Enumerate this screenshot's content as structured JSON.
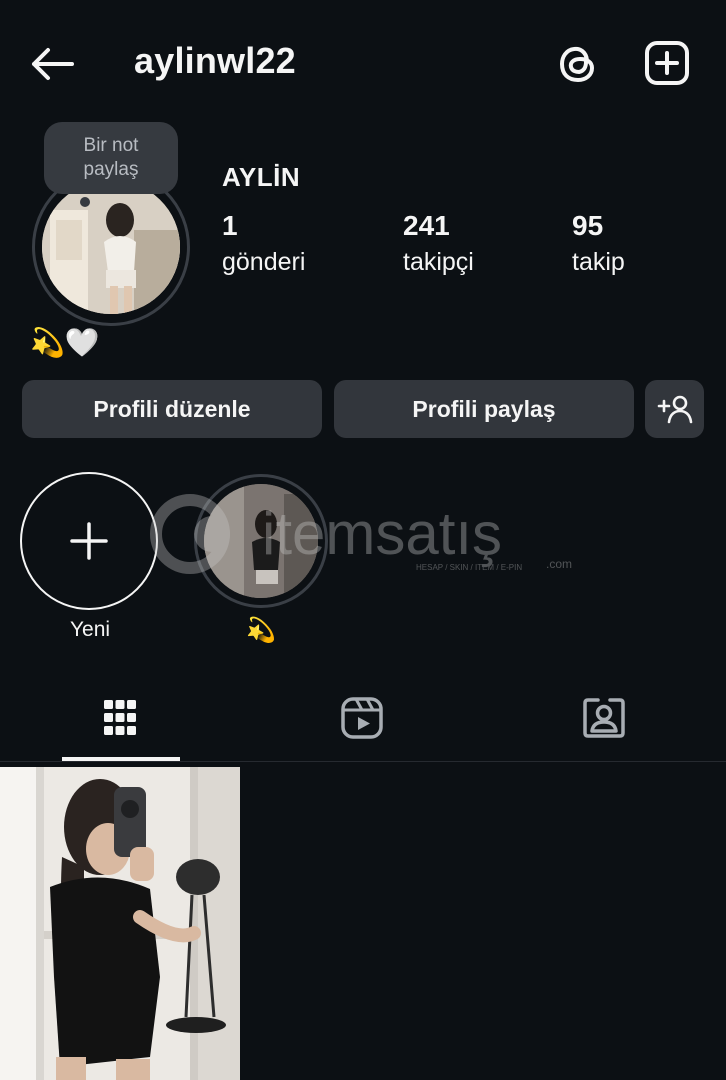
{
  "header": {
    "username": "aylinwl22",
    "back_icon": "arrow-left-icon",
    "threads_icon": "threads-icon",
    "create_icon": "plus-square-icon"
  },
  "profile": {
    "note_text_line1": "Bir not",
    "note_text_line2": "paylaş",
    "display_name": "AYLİN",
    "bio": "💫🤍",
    "stats": {
      "posts_count": "1",
      "posts_label": "gönderi",
      "followers_count": "241",
      "followers_label": "takipçi",
      "following_count": "95",
      "following_label": "takip"
    }
  },
  "actions": {
    "edit_label": "Profili düzenle",
    "share_label": "Profili paylaş",
    "discover_icon": "add-person-icon"
  },
  "highlights": [
    {
      "label": "Yeni",
      "icon": "plus-icon"
    },
    {
      "label": "💫"
    }
  ],
  "watermark": {
    "brand": "itemsatış",
    "tagline": "HESAP / SKIN / ITEM / E-PIN",
    "domain": ".com"
  },
  "tabs": [
    {
      "name": "grid",
      "icon": "grid-icon",
      "selected": true
    },
    {
      "name": "reels",
      "icon": "reels-icon",
      "selected": false
    },
    {
      "name": "tagged",
      "icon": "tagged-person-icon",
      "selected": false
    }
  ],
  "colors": {
    "background": "#0c1014",
    "button": "#32363c",
    "text": "#f5f5f5"
  }
}
